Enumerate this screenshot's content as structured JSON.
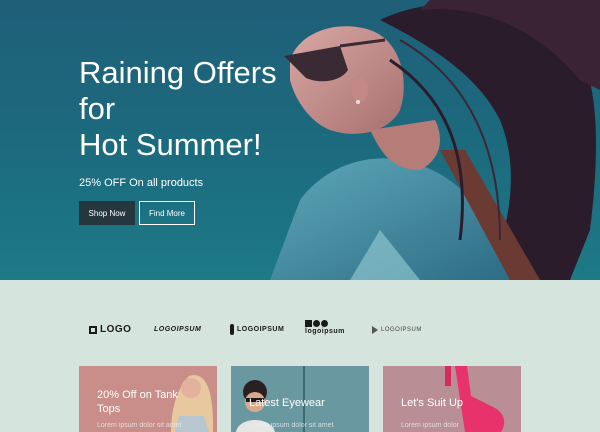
{
  "hero": {
    "title_line1": "Raining Offers",
    "title_line2": "for",
    "title_line3": "Hot Summer!",
    "subtitle": "25% OFF On all products",
    "shop_button": "Shop Now",
    "find_button": "Find More"
  },
  "logos": [
    {
      "name": "LOGO"
    },
    {
      "name": "LOGOIPSUM"
    },
    {
      "name": "LOGOIPSUM"
    },
    {
      "name": "logoipsum"
    },
    {
      "name": "LOGOIPSUM"
    }
  ],
  "cards": [
    {
      "title": "20% Off on Tank Tops",
      "desc": "Lorem ipsum dolor sit amet"
    },
    {
      "title": "Latest Eyewear",
      "desc": "Lorem ipsum dolor sit amet"
    },
    {
      "title": "Let's Suit Up",
      "desc": "Lorem ipsum dolor"
    }
  ],
  "colors": {
    "hero_bg": "#1f6b80",
    "page_bg": "#d5e4dc",
    "button_dark": "#25363f",
    "card_tank": "#c98e89",
    "card_eyewear": "#6a98a0",
    "card_suit": "#b98f95"
  }
}
